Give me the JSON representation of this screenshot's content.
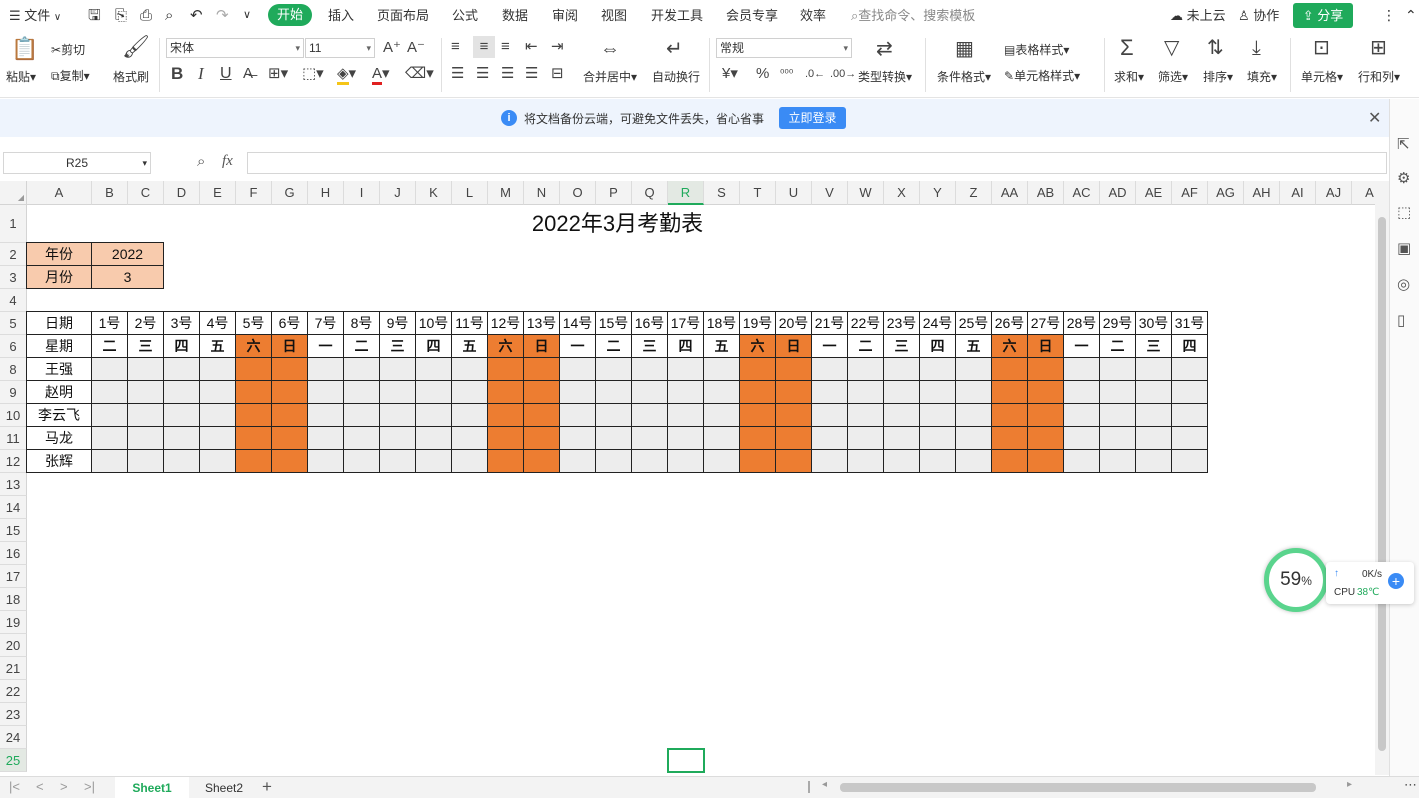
{
  "topbar": {
    "menu_label": "文件",
    "tabs": [
      "开始",
      "插入",
      "页面布局",
      "公式",
      "数据",
      "审阅",
      "视图",
      "开发工具",
      "会员专享",
      "效率"
    ],
    "search_placeholder": "查找命令、搜索模板",
    "cloud_status": "未上云",
    "collab_label": "协作",
    "share_label": "分享"
  },
  "ribbon": {
    "paste": "粘贴",
    "cut": "剪切",
    "copy": "复制",
    "format_painter": "格式刷",
    "font_name": "宋体",
    "font_size": "11",
    "bold": "B",
    "italic": "I",
    "underline": "U",
    "merge": "合并居中",
    "wrap": "自动换行",
    "number_format": "常规",
    "type_convert": "类型转换",
    "cond_format": "条件格式",
    "table_style": "表格样式",
    "cell_style": "单元格样式",
    "sum": "求和",
    "filter": "筛选",
    "sort": "排序",
    "fill": "填充",
    "cell": "单元格",
    "row_col": "行和列"
  },
  "notice": {
    "text": "将文档备份云端，可避免文件丢失，省心省事",
    "button": "立即登录"
  },
  "formula_bar": {
    "name_box": "R25",
    "fx": "fx"
  },
  "sheet": {
    "title": "2022年3月考勤表",
    "year_label": "年份",
    "year_value": "2022",
    "month_label": "月份",
    "month_value": "3",
    "date_label": "日期",
    "weekday_label": "星期",
    "days": [
      "1号",
      "2号",
      "3号",
      "4号",
      "5号",
      "6号",
      "7号",
      "8号",
      "9号",
      "10号",
      "11号",
      "12号",
      "13号",
      "14号",
      "15号",
      "16号",
      "17号",
      "18号",
      "19号",
      "20号",
      "21号",
      "22号",
      "23号",
      "24号",
      "25号",
      "26号",
      "27号",
      "28号",
      "29号",
      "30号",
      "31号"
    ],
    "weekdays": [
      "二",
      "三",
      "四",
      "五",
      "六",
      "日",
      "一",
      "二",
      "三",
      "四",
      "五",
      "六",
      "日",
      "一",
      "二",
      "三",
      "四",
      "五",
      "六",
      "日",
      "一",
      "二",
      "三",
      "四",
      "五",
      "六",
      "日",
      "一",
      "二",
      "三",
      "四"
    ],
    "employees": [
      "王强",
      "赵明",
      "李云飞",
      "马龙",
      "张辉"
    ],
    "weekend_color": "#ed7d31",
    "workday_color": "#ededed",
    "header_color": "#f8cbad"
  },
  "col_headers": [
    "A",
    "B",
    "C",
    "D",
    "E",
    "F",
    "G",
    "H",
    "I",
    "J",
    "K",
    "L",
    "M",
    "N",
    "O",
    "P",
    "Q",
    "R",
    "S",
    "T",
    "U",
    "V",
    "W",
    "X",
    "Y",
    "Z",
    "AA",
    "AB",
    "AC",
    "AD",
    "AE",
    "AF",
    "AG",
    "AH",
    "AI",
    "AJ",
    "A"
  ],
  "row_headers": [
    "1",
    "2",
    "3",
    "4",
    "5",
    "6",
    "8",
    "9",
    "10",
    "11",
    "12",
    "13",
    "14",
    "15",
    "16",
    "17",
    "18",
    "19",
    "20",
    "21",
    "22",
    "23",
    "24",
    "25"
  ],
  "selected_col": "R",
  "selected_row": "25",
  "sheets": [
    "Sheet1",
    "Sheet2"
  ],
  "active_sheet": "Sheet1",
  "sysmon": {
    "cpu_percent": "59",
    "percent_sign": "%",
    "net_speed": "0K/s",
    "cpu_label": "CPU",
    "cpu_temp": "38℃"
  }
}
